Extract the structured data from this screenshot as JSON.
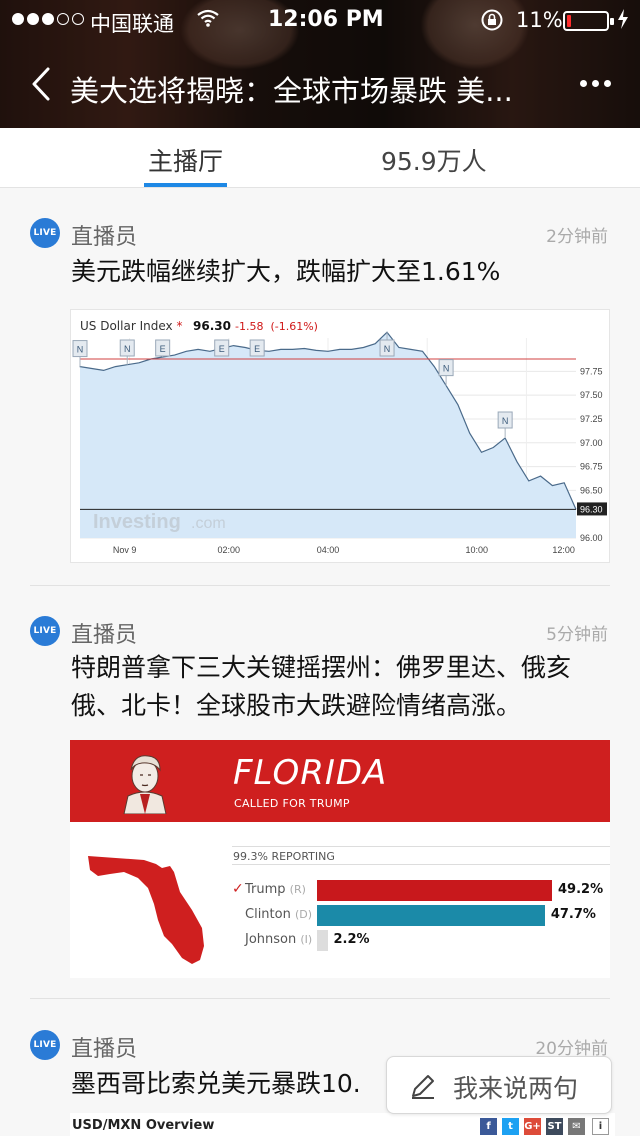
{
  "status_bar": {
    "carrier": "中国联通",
    "time": "12:06 PM",
    "battery_percent": "11%",
    "battery_level": 0.11
  },
  "nav": {
    "title": "美大选将揭晓：全球市场暴跌 美..."
  },
  "tabs": {
    "main": "主播厅",
    "viewers": "95.9万人"
  },
  "feed": [
    {
      "badge": "LIVE",
      "author": "直播员",
      "time_ago": "2分钟前",
      "text": "美元跌幅继续扩大，跌幅扩大至1.61%",
      "chart": {
        "title": "US Dollar Index",
        "star": "*",
        "value": "96.30",
        "change": "-1.58",
        "change_pct": "(-1.61%)",
        "watermark": "Investing",
        "watermark_suffix": ".com"
      }
    },
    {
      "badge": "LIVE",
      "author": "直播员",
      "time_ago": "5分钟前",
      "text": "特朗普拿下三大关键摇摆州：佛罗里达、俄亥俄、北卡！全球股市大跌避险情绪高涨。",
      "result": {
        "state": "FLORIDA",
        "called": "CALLED FOR TRUMP",
        "reporting": "99.3% REPORTING",
        "candidates": [
          {
            "name": "Trump",
            "party": "(R)",
            "pct_label": "49.2%",
            "pct": 49.2,
            "winner": true,
            "color": "#c8181c"
          },
          {
            "name": "Clinton",
            "party": "(D)",
            "pct_label": "47.7%",
            "pct": 47.7,
            "winner": false,
            "color": "#1b8aa8"
          },
          {
            "name": "Johnson",
            "party": "(I)",
            "pct_label": "2.2%",
            "pct": 2.2,
            "winner": false,
            "color": "#dddddd"
          }
        ]
      }
    },
    {
      "badge": "LIVE",
      "author": "直播员",
      "time_ago": "20分钟前",
      "text": "墨西哥比索兑美元暴跌10.",
      "overview_title": "USD/MXN Overview"
    }
  ],
  "chart_data": {
    "type": "line",
    "title": "US Dollar Index",
    "x_tick_labels": [
      "Nov 9",
      "02:00",
      "04:00",
      "10:00",
      "12:00"
    ],
    "y_tick_labels": [
      "97.75",
      "97.50",
      "97.25",
      "97.00",
      "96.75",
      "96.50",
      "96.30",
      "96.00"
    ],
    "ylim": [
      96.0,
      98.1
    ],
    "reference_line": 97.88,
    "last_value": 96.3,
    "series": [
      {
        "values": [
          97.8,
          97.78,
          97.76,
          97.8,
          97.82,
          97.84,
          97.88,
          97.9,
          97.92,
          97.96,
          97.98,
          97.96,
          97.99,
          98.02,
          98.0,
          97.97,
          97.96,
          97.98,
          97.98,
          97.99,
          97.97,
          97.96,
          97.98,
          97.98,
          98.0,
          98.04,
          98.16,
          98.0,
          97.98,
          97.96,
          97.8,
          97.6,
          97.4,
          97.1,
          96.9,
          96.95,
          97.05,
          96.8,
          96.6,
          96.65,
          96.55,
          96.58,
          96.3
        ]
      }
    ],
    "markers": [
      {
        "label": "N",
        "x_index": 0
      },
      {
        "label": "N",
        "x_index": 4
      },
      {
        "label": "E",
        "x_index": 7
      },
      {
        "label": "E",
        "x_index": 12
      },
      {
        "label": "E",
        "x_index": 15
      },
      {
        "label": "N",
        "x_index": 26
      },
      {
        "label": "N",
        "x_index": 31
      },
      {
        "label": "N",
        "x_index": 36
      }
    ],
    "grid": true,
    "legend": "none"
  },
  "comment": {
    "placeholder": "我来说两句"
  },
  "share_icons": [
    "f",
    "t",
    "G+",
    "ST",
    "✉",
    "i"
  ],
  "colors": {
    "accent": "#1e88e5",
    "live": "#2a7bd6",
    "chart_fill": "#d6e8f8",
    "chart_line": "#4a6a8a",
    "banner_red": "#cf1f1f"
  }
}
